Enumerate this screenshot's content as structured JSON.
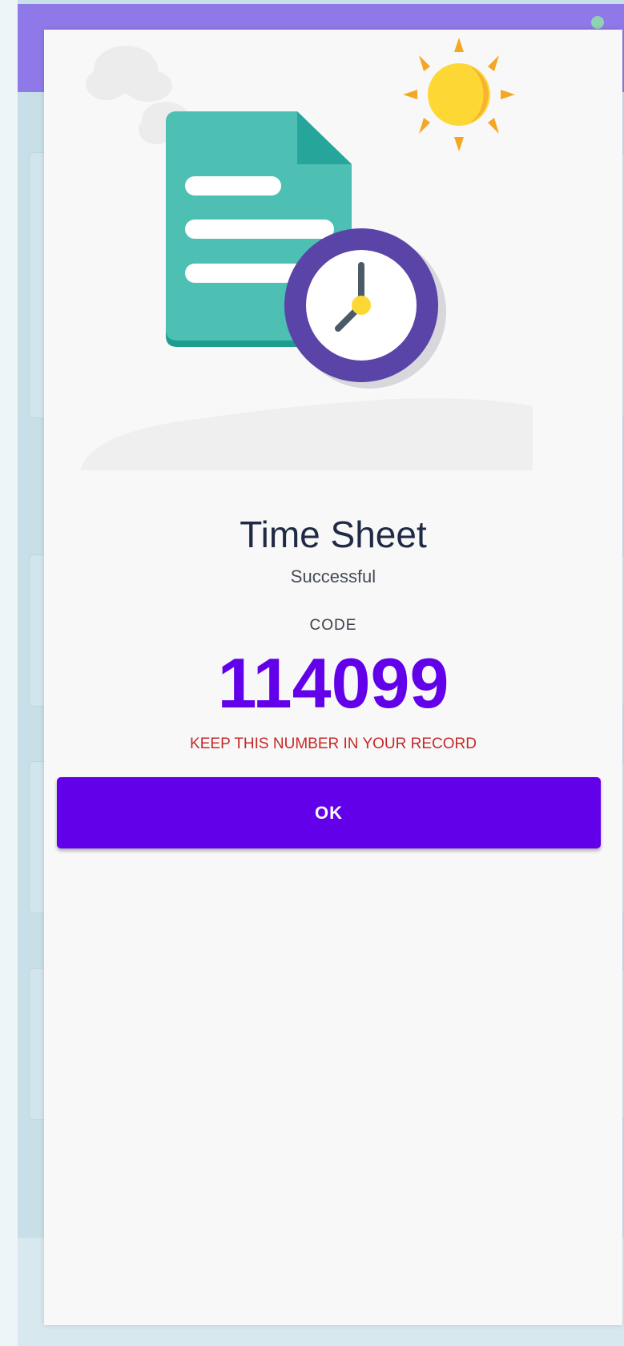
{
  "dialog": {
    "title": "Time Sheet",
    "subtitle": "Successful",
    "code_label": "CODE",
    "code_value": "114099",
    "warning": "KEEP THIS NUMBER IN YOUR RECORD",
    "ok_label": "OK"
  },
  "colors": {
    "accent": "#6200ea",
    "header": "#8f79e9",
    "warning": "#c62828",
    "title": "#1f2a44"
  },
  "icons": {
    "document": "document-icon",
    "clock": "clock-icon",
    "sun": "sun-icon",
    "clouds": "cloud-icon"
  }
}
